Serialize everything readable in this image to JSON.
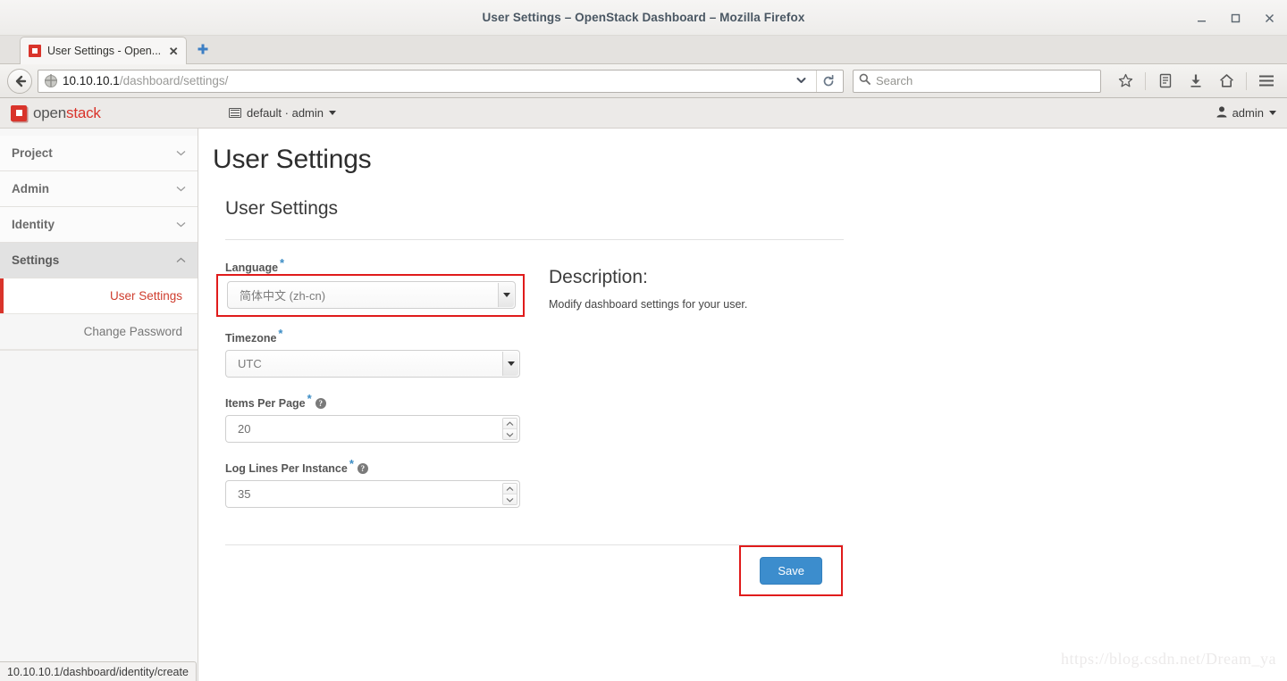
{
  "window": {
    "title": "User Settings – OpenStack Dashboard – Mozilla Firefox",
    "minimize_label": "–",
    "maximize_label": "□",
    "close_label": "✕"
  },
  "browser": {
    "tab": {
      "title": "User Settings - Open...",
      "close_label": "✕",
      "favicon": "openstack-favicon"
    },
    "new_tab_label": "✚",
    "back_label": "←",
    "url": {
      "host": "10.10.10.1",
      "path": "/dashboard/settings/",
      "dropdown_label": "⌄",
      "reload_label": "⟳"
    },
    "search": {
      "placeholder": "Search",
      "icon": "search-icon"
    },
    "toolbar_icons": [
      {
        "name": "bookmark-star-icon",
        "glyph": "☆"
      },
      {
        "name": "library-icon",
        "glyph": "▤"
      },
      {
        "name": "downloads-icon",
        "glyph": "⭳"
      },
      {
        "name": "home-icon",
        "glyph": "⌂"
      },
      {
        "name": "menu-hamburger-icon",
        "glyph": "☰"
      }
    ],
    "status_bar": "10.10.10.1/dashboard/identity/create"
  },
  "dashboard_header": {
    "logo_text_1": "open",
    "logo_text_2": "stack",
    "context": "default · admin",
    "context_caret": "▾",
    "user": "admin",
    "user_caret": "▾"
  },
  "sidebar": {
    "groups": [
      {
        "label": "Project",
        "expanded": false,
        "chevron": "⌄"
      },
      {
        "label": "Admin",
        "expanded": false,
        "chevron": "⌄"
      },
      {
        "label": "Identity",
        "expanded": false,
        "chevron": "⌄"
      },
      {
        "label": "Settings",
        "expanded": true,
        "chevron": "⌃"
      }
    ],
    "settings_items": [
      {
        "label": "User Settings",
        "active": true
      },
      {
        "label": "Change Password",
        "active": false
      }
    ]
  },
  "main": {
    "page_title": "User Settings",
    "panel_title": "User Settings",
    "fields": {
      "language": {
        "label": "Language",
        "required_mark": "*",
        "value": "简体中文 (zh-cn)",
        "highlighted": true
      },
      "timezone": {
        "label": "Timezone",
        "required_mark": "*",
        "value": "UTC"
      },
      "items_per_page": {
        "label": "Items Per Page",
        "required_mark": "*",
        "help_mark": "?",
        "value": "20"
      },
      "log_lines": {
        "label": "Log Lines Per Instance",
        "required_mark": "*",
        "help_mark": "?",
        "value": "35"
      }
    },
    "description": {
      "title": "Description:",
      "body": "Modify dashboard settings for your user."
    },
    "save_button": "Save",
    "watermark": "https://blog.csdn.net/Dream_ya"
  },
  "colors": {
    "brand_red": "#d9342b",
    "highlight_red": "#e01b1b",
    "primary_blue": "#3c8dcd",
    "required_blue": "#3c8dc5"
  }
}
